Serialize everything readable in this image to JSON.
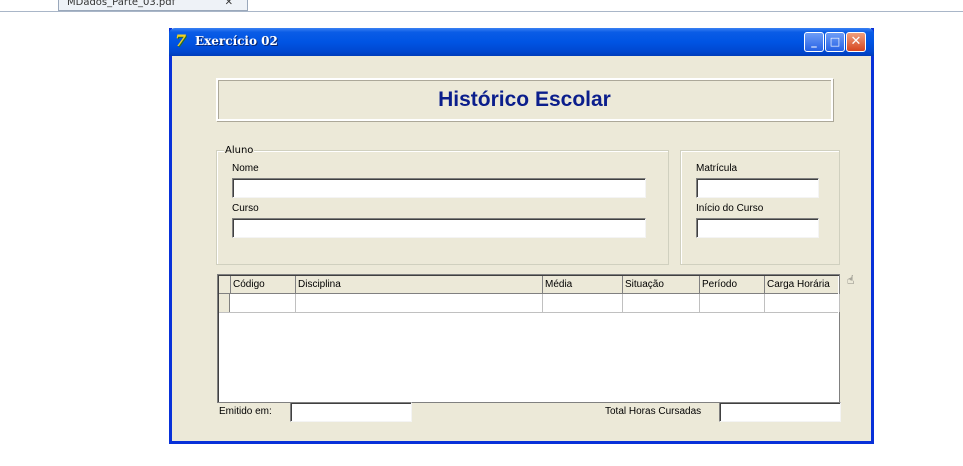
{
  "pdf_viewer": {
    "tab_label": "MDados_Parte_03.pdf",
    "tab_close": "✕"
  },
  "window": {
    "title": "Exercício 02",
    "icon": "delphi-app-icon",
    "minimize_glyph": "_",
    "maximize_glyph": "□",
    "close_glyph": "✕"
  },
  "heading": "Histórico Escolar",
  "aluno_group": {
    "legend": "Aluno",
    "nome_label": "Nome",
    "nome_value": "",
    "curso_label": "Curso",
    "curso_value": ""
  },
  "right_group": {
    "matricula_label": "Matrícula",
    "matricula_value": "",
    "inicio_label": "Início do Curso",
    "inicio_value": ""
  },
  "grid": {
    "columns": [
      "Código",
      "Disciplina",
      "Média",
      "Situação",
      "Período",
      "Carga Horária"
    ],
    "rows": [
      [
        "",
        "",
        "",
        "",
        "",
        ""
      ]
    ]
  },
  "footer": {
    "emitido_label": "Emitido em:",
    "emitido_value": "",
    "total_label": "Total Horas Cursadas",
    "total_value": ""
  },
  "colors": {
    "titlebar": "#0054e3",
    "heading_text": "#0b1e8c",
    "form_background": "#ece9d8"
  }
}
